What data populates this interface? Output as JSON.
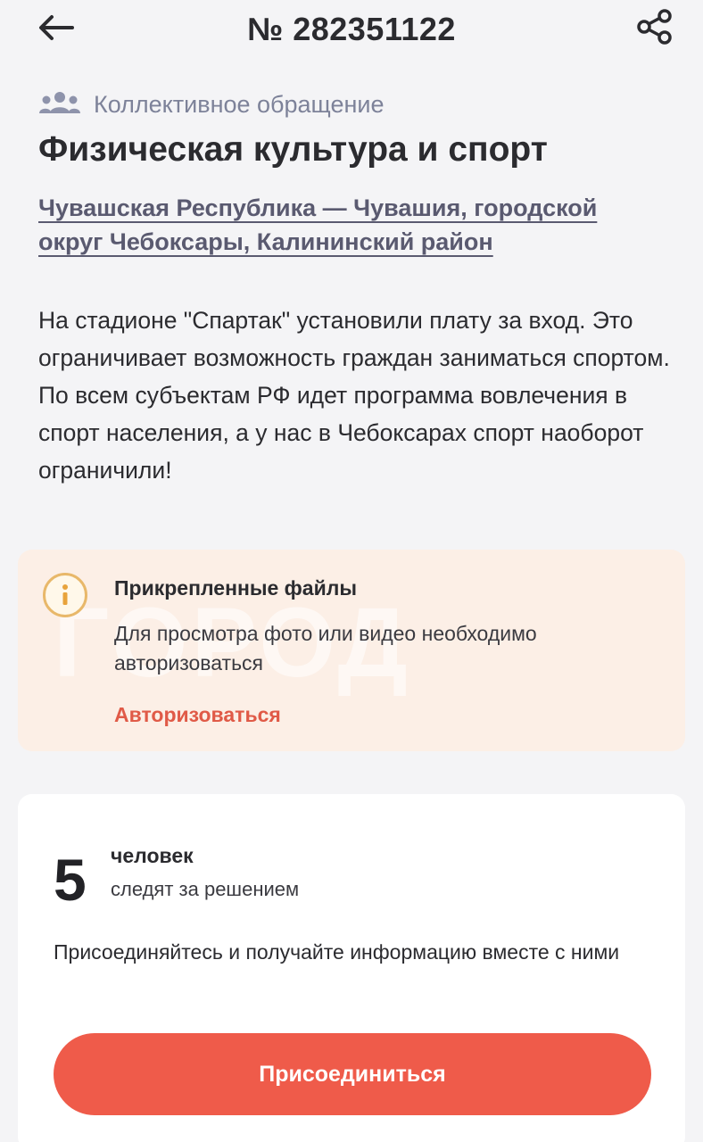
{
  "header": {
    "title": "№ 282351122"
  },
  "category": {
    "label": "Коллективное обращение",
    "icon": "group-icon"
  },
  "main": {
    "title": "Физическая культура и спорт",
    "location": "Чувашская Республика — Чувашия, городской округ Чебоксары, Калининский район",
    "description": "На стадионе \"Спартак\" установили плату за вход. Это ограничивает возможность граждан заниматься спортом. По всем субъектам РФ идет программа вовлечения в спорт населения, а у нас в Чебоксарах спорт наоборот ограничили!"
  },
  "attachments": {
    "title": "Прикрепленные файлы",
    "text": "Для просмотра фото или видео необходимо авторизоваться",
    "link_label": "Авторизоваться",
    "watermark": "ГОРОД"
  },
  "followers": {
    "count": "5",
    "word": "человек",
    "sub": "следят за решением",
    "note": "Присоединяйтесь и получайте информацию вместе с ними",
    "button_label": "Присоединиться"
  },
  "colors": {
    "accent": "#ef5b4a",
    "link_red": "#e05a47",
    "attach_bg": "#fcefe6",
    "muted": "#7d8299"
  }
}
